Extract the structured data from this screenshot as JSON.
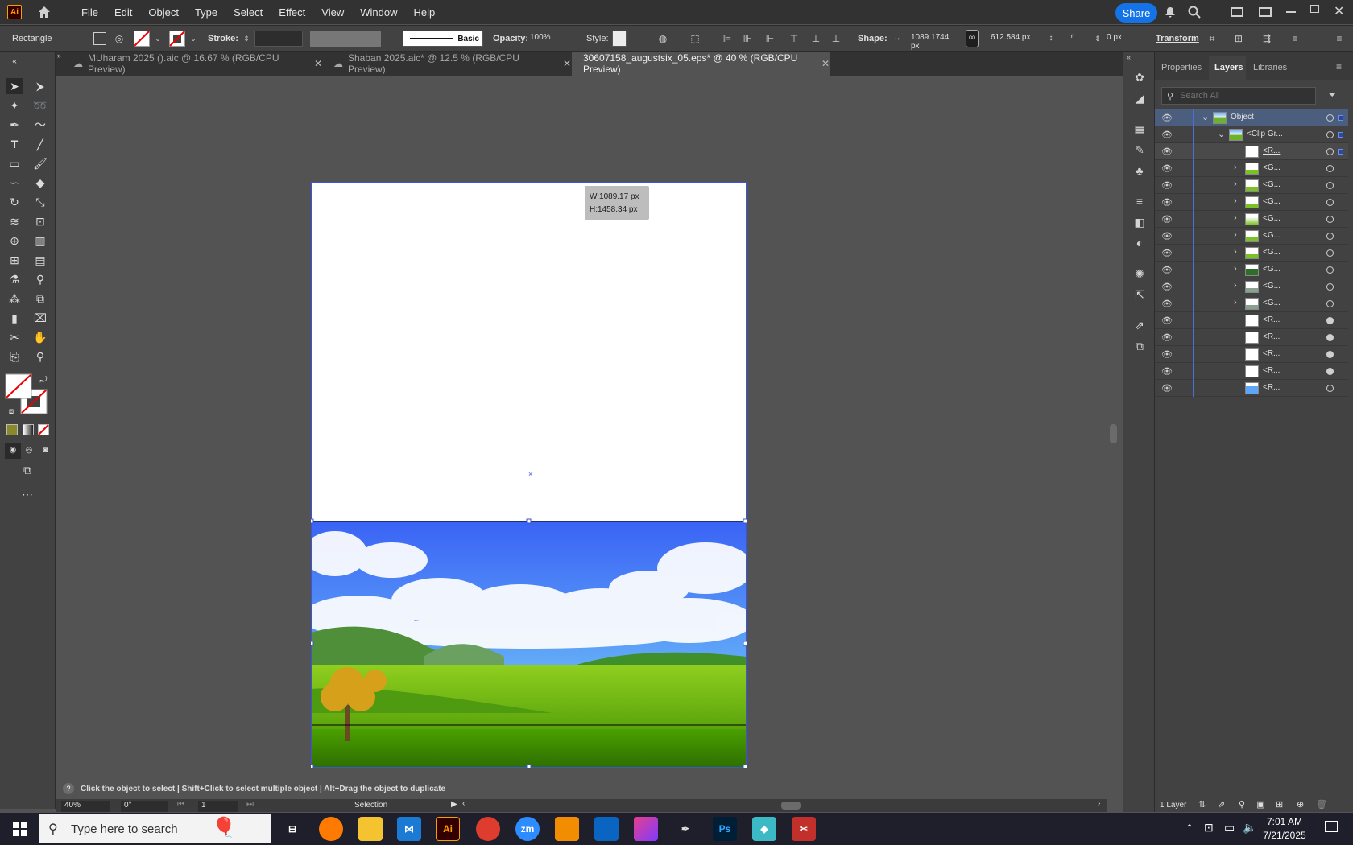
{
  "app": {
    "logo": "Ai"
  },
  "menu": [
    "File",
    "Edit",
    "Object",
    "Type",
    "Select",
    "Effect",
    "View",
    "Window",
    "Help"
  ],
  "share_label": "Share",
  "controlbar": {
    "selection_label": "Rectangle",
    "stroke_label": "Stroke:",
    "brush_label": "Basic",
    "opacity_label": "Opacity:",
    "opacity_value": "100%",
    "style_label": "Style:",
    "shape_label": "Shape:",
    "width_value": "1089.1744 px",
    "height_value": "612.584 px",
    "corner_value": "0 px",
    "transform_label": "Transform"
  },
  "tabs": [
    {
      "label": "MUharam 2025 ().aic @ 16.67 % (RGB/CPU Preview)"
    },
    {
      "label": "Shaban 2025.aic* @ 12.5 % (RGB/CPU Preview)"
    },
    {
      "label": "30607158_augustsix_05.eps* @ 40 % (RGB/CPU Preview)"
    }
  ],
  "tooltip": {
    "w": "W:1089.17 px",
    "h": "H:1458.34 px"
  },
  "status_hint": "Click the object to select  |  Shift+Click to select multiple object  |  Alt+Drag the object to duplicate",
  "bottombar": {
    "zoom": "40%",
    "rotation": "0°",
    "artboard": "1",
    "mode": "Selection"
  },
  "panel": {
    "tabs": [
      "Properties",
      "Layers",
      "Libraries"
    ],
    "search_placeholder": "Search All",
    "layers": [
      {
        "name": "Object",
        "thumb": "landscape"
      },
      {
        "name": "<Clip Gr...",
        "thumb": "landscape"
      },
      {
        "name": "<R...",
        "thumb": "white"
      },
      {
        "name": "<G...",
        "thumb": "green"
      },
      {
        "name": "<G...",
        "thumb": "green"
      },
      {
        "name": "<G...",
        "thumb": "green"
      },
      {
        "name": "<G...",
        "thumb": "tree"
      },
      {
        "name": "<G...",
        "thumb": "green"
      },
      {
        "name": "<G...",
        "thumb": "green"
      },
      {
        "name": "<G...",
        "thumb": "dark"
      },
      {
        "name": "<G...",
        "thumb": "grey"
      },
      {
        "name": "<G...",
        "thumb": "grey"
      },
      {
        "name": "<R...",
        "thumb": "white"
      },
      {
        "name": "<R...",
        "thumb": "white"
      },
      {
        "name": "<R...",
        "thumb": "white"
      },
      {
        "name": "<R...",
        "thumb": "white"
      },
      {
        "name": "<R...",
        "thumb": "sky"
      }
    ],
    "footer_label": "1 Layer"
  },
  "taskbar": {
    "search_placeholder": "Type here to search",
    "time": "7:01 AM",
    "date": "7/21/2025",
    "apps": [
      "Ai",
      "zm",
      "Ps"
    ]
  },
  "colors": {
    "accent": "#1473e6",
    "ai_orange": "#ff9a00",
    "sky_top": "#3a63f5",
    "grass": "#5aa800"
  }
}
